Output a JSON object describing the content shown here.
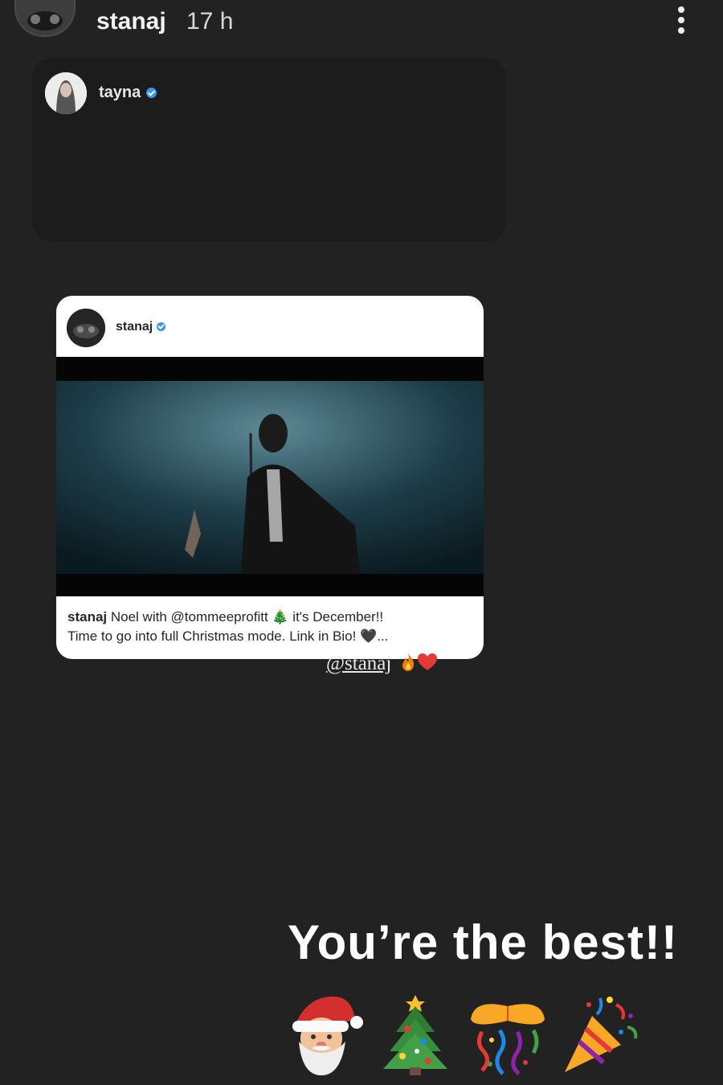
{
  "story": {
    "username": "stanaj",
    "timestamp": "17 h",
    "more_icon": "more-vertical-icon"
  },
  "shared_story": {
    "username": "tayna",
    "verified": true
  },
  "post": {
    "username": "stanaj",
    "verified": true,
    "caption_user": "stanaj",
    "caption_line1": "Noel with @tommeeprofitt 🎄 it's December!!",
    "caption_line2": "Time to go into full Christmas mode. Link in Bio! 🖤..."
  },
  "mention": {
    "text": "@stanaj",
    "emojis": [
      "fire-icon",
      "heart-icon"
    ]
  },
  "message": "You’re the best!!",
  "emojis": [
    "santa-emoji",
    "christmas-tree-emoji",
    "confetti-ball-emoji",
    "party-popper-emoji"
  ],
  "colors": {
    "background": "#222222",
    "verified_blue": "#3897f0",
    "card_white": "#ffffff"
  }
}
